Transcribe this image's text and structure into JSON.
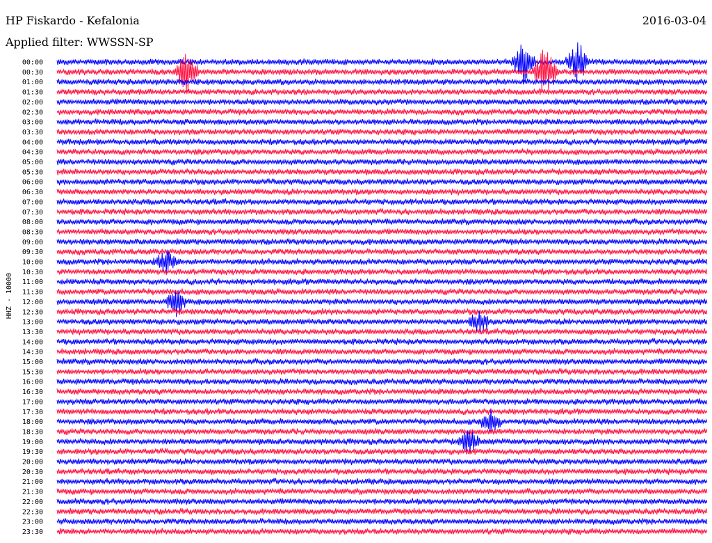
{
  "chart_data": {
    "type": "line",
    "title": "HP Fiskardo - Kefalonia",
    "subtitle": "Applied filter: WWSSN-SP",
    "date": "2016-03-04",
    "ylabel": "HHZ - 10000",
    "xlabel": "",
    "tick_labels": [
      "00:00",
      "00:30",
      "01:00",
      "01:30",
      "02:00",
      "02:30",
      "03:00",
      "03:30",
      "04:00",
      "04:30",
      "05:00",
      "05:30",
      "06:00",
      "06:30",
      "07:00",
      "07:30",
      "08:00",
      "08:30",
      "09:00",
      "09:30",
      "10:00",
      "10:30",
      "11:00",
      "11:30",
      "12:00",
      "12:30",
      "13:00",
      "13:30",
      "14:00",
      "14:30",
      "15:00",
      "15:30",
      "16:00",
      "16:30",
      "17:00",
      "17:30",
      "18:00",
      "18:30",
      "19:00",
      "19:30",
      "20:00",
      "20:30",
      "21:00",
      "21:30",
      "22:00",
      "22:30",
      "23:00",
      "23:30"
    ],
    "series_colors": [
      "#0000ff",
      "#ff0f3f"
    ],
    "grid": false,
    "legend": "none",
    "events": [
      {
        "row": 0,
        "minute": 21.5,
        "amplitude": 6.0
      },
      {
        "row": 0,
        "minute": 24.0,
        "amplitude": 6.0
      },
      {
        "row": 1,
        "minute": 6.0,
        "amplitude": 6.0
      },
      {
        "row": 1,
        "minute": 22.5,
        "amplitude": 7.0
      },
      {
        "row": 20,
        "minute": 5.0,
        "amplitude": 3.0
      },
      {
        "row": 24,
        "minute": 5.5,
        "amplitude": 3.5
      },
      {
        "row": 26,
        "minute": 19.5,
        "amplitude": 3.0
      },
      {
        "row": 36,
        "minute": 20.0,
        "amplitude": 3.0
      },
      {
        "row": 38,
        "minute": 19.0,
        "amplitude": 3.0
      }
    ]
  }
}
